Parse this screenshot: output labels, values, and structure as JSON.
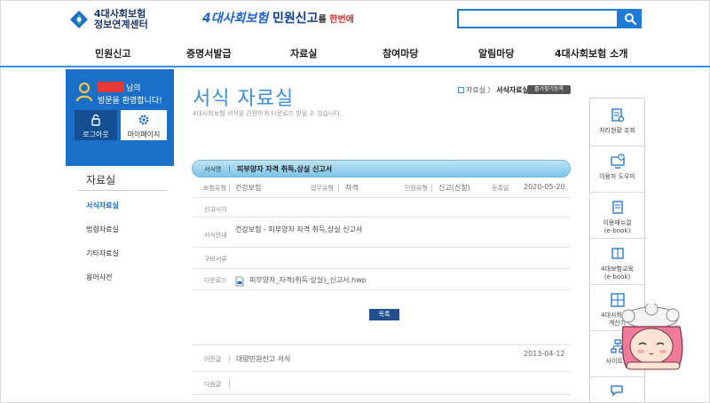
{
  "header": {
    "logo_text": "4대사회보험\n정보연계센터",
    "banner": {
      "part1": "4대사회보험",
      "part2": " 민원신고",
      "part3": "를 ",
      "part4": "한번에"
    },
    "search_placeholder": ""
  },
  "gnb": {
    "items": [
      "민원신고",
      "증명서발급",
      "자료실",
      "참여마당",
      "알림마당",
      "4대사회보험 소개"
    ]
  },
  "user": {
    "name_suffix": "님의",
    "welcome": "방문을 환영합니다!",
    "logout_label": "로그아웃",
    "mypage_label": "마이페이지"
  },
  "sidebar": {
    "title": "자료실",
    "items": [
      "서식자료실",
      "법령자료실",
      "기타자료실",
      "용어사전"
    ]
  },
  "main": {
    "title": "서식 자료실",
    "description": "4대사회보험 서식을 간편하게 다운로드 받을 수 있습니다.",
    "breadcrumb": {
      "parent": "자료실",
      "sep": "〉",
      "current": "서식자료실"
    },
    "favorite_label": "즐겨찾기등록"
  },
  "detail": {
    "form_name_label": "서식명",
    "form_name": "피부양자 자격 취득,상실 신고서",
    "insurance_label": "보험유형",
    "insurance_value": "건강보험",
    "work_label": "업무유형",
    "work_value": "자격",
    "civil_label": "민원유형",
    "civil_value": "신고(신청)",
    "date_label": "등록일",
    "date_value": "2020-05-20",
    "timing_label": "신고시기",
    "timing_value": "",
    "guide_label": "서식안내",
    "guide_value": "건강보험 - 피부양자 자격 취득,상실 신고서",
    "docs_label": "구비서류",
    "docs_value": "",
    "download_label": "다운로드",
    "download_file": "피부양자_자격(취득·상실)_신고서.hwp",
    "list_button": "목록"
  },
  "nav": {
    "prev_label": "이전글",
    "prev_title": "대량민원신고 서식",
    "prev_date": "2013-04-12",
    "next_label": "다음글",
    "next_title": ""
  },
  "quick_menu": {
    "items": [
      {
        "label": "처리현황 조회",
        "icon": "document-search-icon"
      },
      {
        "label": "이용자 도우미",
        "icon": "help-monitor-icon"
      },
      {
        "label": "이용매뉴얼\n(e-book)",
        "icon": "ebook-icon"
      },
      {
        "label": "4대보험교육\n(e-book)",
        "icon": "education-book-icon"
      },
      {
        "label": "4대사회보험\n계산기",
        "icon": "calculator-icon"
      },
      {
        "label": "사이트맵",
        "icon": "sitemap-icon"
      },
      {
        "label": "",
        "icon": "chat-icon"
      }
    ]
  },
  "colors": {
    "primary_blue": "#1a6fc8",
    "title_blue": "#3c8fd8",
    "title_bar": "#7cc4e7",
    "mask_red": "#e53935"
  }
}
